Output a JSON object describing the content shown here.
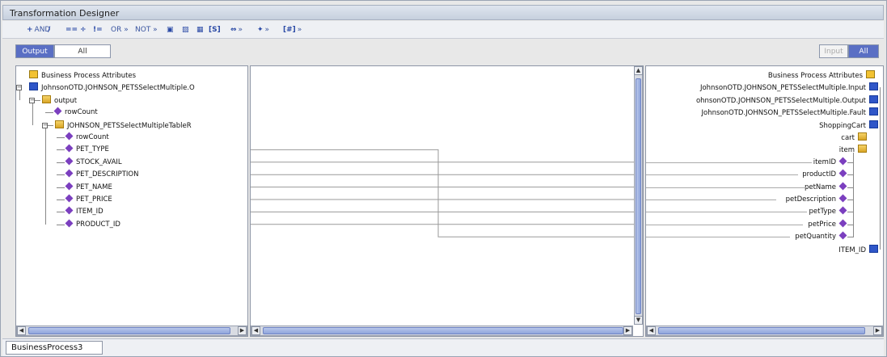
{
  "title": "Transformation Designer",
  "toolbar": [
    {
      "icon": "+",
      "label": "AND",
      "name": "and-button"
    },
    {
      "icon": "/",
      "label": "",
      "name": "divide-button"
    },
    {
      "icon": "==",
      "label": "",
      "name": "equals-button"
    },
    {
      "icon": "÷",
      "label": "",
      "name": "divide-op-button"
    },
    {
      "icon": "!=",
      "label": "",
      "name": "not-equals-button"
    },
    {
      "icon": "",
      "label": "OR »",
      "name": "or-button"
    },
    {
      "icon": "",
      "label": "NOT »",
      "name": "not-button"
    },
    {
      "icon": "▣",
      "label": "",
      "name": "string-button"
    },
    {
      "icon": "▨",
      "label": "",
      "name": "copy-button"
    },
    {
      "icon": "▦",
      "label": "",
      "name": "paste-button"
    },
    {
      "icon": "[S]",
      "label": "",
      "name": "select-button"
    },
    {
      "icon": "⇔",
      "label": "»",
      "name": "link-button"
    },
    {
      "icon": "✦",
      "label": "»",
      "name": "node-button"
    },
    {
      "icon": "[#]",
      "label": "»",
      "name": "number-button"
    }
  ],
  "left_tabs": {
    "output": "Output",
    "all": "All"
  },
  "right_tabs": {
    "input": "Input",
    "all": "All"
  },
  "left_tree": [
    {
      "text": "Business Process Attributes",
      "depth": 0,
      "icon": "root"
    },
    {
      "text": "JohnsonOTD.JOHNSON_PETSSelectMultiple.O",
      "depth": 0,
      "icon": "comp"
    },
    {
      "text": "output",
      "depth": 1,
      "icon": "folder"
    },
    {
      "text": "rowCount",
      "depth": 2,
      "icon": "diamond"
    },
    {
      "text": "JOHNSON_PETSSelectMultipleTableR",
      "depth": 2,
      "icon": "folder"
    },
    {
      "text": "rowCount",
      "depth": 3,
      "icon": "diamond"
    },
    {
      "text": "PET_TYPE",
      "depth": 3,
      "icon": "diamond"
    },
    {
      "text": "STOCK_AVAIL",
      "depth": 3,
      "icon": "diamond"
    },
    {
      "text": "PET_DESCRIPTION",
      "depth": 3,
      "icon": "diamond"
    },
    {
      "text": "PET_NAME",
      "depth": 3,
      "icon": "diamond"
    },
    {
      "text": "PET_PRICE",
      "depth": 3,
      "icon": "diamond"
    },
    {
      "text": "ITEM_ID",
      "depth": 3,
      "icon": "diamond"
    },
    {
      "text": "PRODUCT_ID",
      "depth": 3,
      "icon": "diamond"
    }
  ],
  "right_tree": [
    {
      "text": "Business Process Attributes",
      "icon": "root"
    },
    {
      "text": "JohnsonOTD.JOHNSON_PETSSelectMultiple.Input",
      "icon": "comp"
    },
    {
      "text": "ohnsonOTD.JOHNSON_PETSSelectMultiple.Output",
      "icon": "comp"
    },
    {
      "text": "JohnsonOTD.JOHNSON_PETSSelectMultiple.Fault",
      "icon": "comp"
    },
    {
      "text": "ShoppingCart",
      "icon": "comp"
    },
    {
      "text": "cart",
      "icon": "folder"
    },
    {
      "text": "item",
      "icon": "folder"
    },
    {
      "text": "itemID",
      "icon": "diamond"
    },
    {
      "text": "productID",
      "icon": "diamond"
    },
    {
      "text": "petName",
      "icon": "diamond"
    },
    {
      "text": "petDescription",
      "icon": "diamond"
    },
    {
      "text": "petType",
      "icon": "diamond"
    },
    {
      "text": "petPrice",
      "icon": "diamond"
    },
    {
      "text": "petQuantity",
      "icon": "diamond"
    },
    {
      "text": "ITEM_ID",
      "icon": "comp"
    }
  ],
  "mappings": [
    {
      "from": "PET_TYPE",
      "to": "petType"
    },
    {
      "from": "STOCK_AVAIL",
      "to": "petQuantity"
    },
    {
      "from": "PET_DESCRIPTION",
      "to": "petDescription"
    },
    {
      "from": "PET_NAME",
      "to": "petName"
    },
    {
      "from": "PET_PRICE",
      "to": "petPrice"
    },
    {
      "from": "ITEM_ID",
      "to": "itemID"
    },
    {
      "from": "PRODUCT_ID",
      "to": "productID"
    }
  ],
  "bottom_tab": "BusinessProcess3"
}
